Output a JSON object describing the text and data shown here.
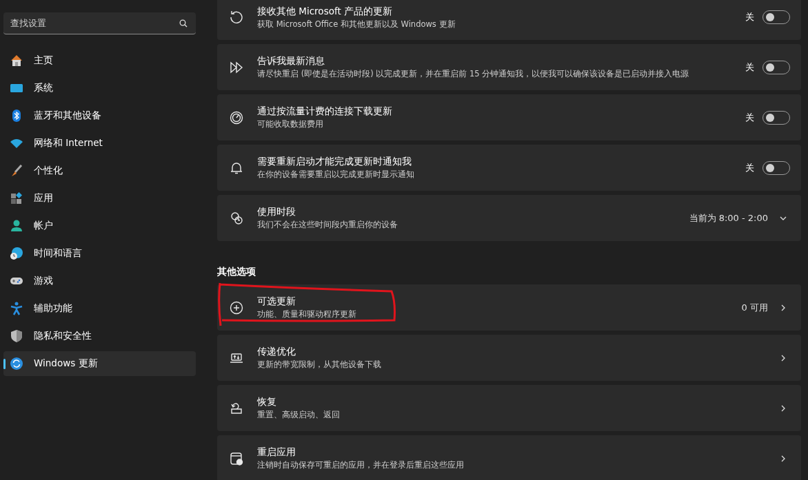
{
  "sidebar": {
    "search": {
      "placeholder": "查找设置"
    },
    "items": [
      {
        "label": "主页",
        "selected": false
      },
      {
        "label": "系统",
        "selected": false
      },
      {
        "label": "蓝牙和其他设备",
        "selected": false
      },
      {
        "label": "网络和 Internet",
        "selected": false
      },
      {
        "label": "个性化",
        "selected": false
      },
      {
        "label": "应用",
        "selected": false
      },
      {
        "label": "帐户",
        "selected": false
      },
      {
        "label": "时间和语言",
        "selected": false
      },
      {
        "label": "游戏",
        "selected": false
      },
      {
        "label": "辅助功能",
        "selected": false
      },
      {
        "label": "隐私和安全性",
        "selected": false
      },
      {
        "label": "Windows 更新",
        "selected": true
      }
    ]
  },
  "settings": [
    {
      "kind": "toggle",
      "title": "接收其他 Microsoft 产品的更新",
      "subtitle": "获取 Microsoft Office 和其他更新以及 Windows 更新",
      "state_label": "关",
      "on": false
    },
    {
      "kind": "toggle",
      "title": "告诉我最新消息",
      "subtitle": "请尽快重启 (即使是在活动时段) 以完成更新，并在重启前 15 分钟通知我，以便我可以确保该设备是已启动并接入电源",
      "state_label": "关",
      "on": false
    },
    {
      "kind": "toggle",
      "title": "通过按流量计费的连接下载更新",
      "subtitle": "可能收取数据费用",
      "state_label": "关",
      "on": false
    },
    {
      "kind": "toggle",
      "title": "需要重新启动才能完成更新时通知我",
      "subtitle": "在你的设备需要重启以完成更新时显示通知",
      "state_label": "关",
      "on": false
    },
    {
      "kind": "dropdown",
      "title": "使用时段",
      "subtitle": "我们不会在这些时间段内重启你的设备",
      "value": "当前为 8:00 - 2:00"
    }
  ],
  "other_options": {
    "heading": "其他选项",
    "items": [
      {
        "kind": "link",
        "title": "可选更新",
        "subtitle": "功能、质量和驱动程序更新",
        "value": "0 可用"
      },
      {
        "kind": "link",
        "title": "传递优化",
        "subtitle": "更新的带宽限制，从其他设备下载"
      },
      {
        "kind": "link",
        "title": "恢复",
        "subtitle": "重置、高级启动、返回"
      },
      {
        "kind": "link",
        "title": "重启应用",
        "subtitle": "注销时自动保存可重启的应用，并在登录后重启这些应用"
      }
    ]
  }
}
